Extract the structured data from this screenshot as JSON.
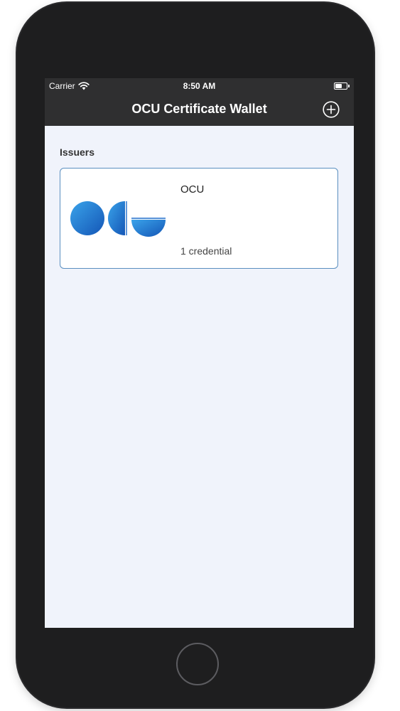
{
  "status_bar": {
    "carrier": "Carrier",
    "time": "8:50 AM",
    "icons": [
      "wifi-icon",
      "battery-icon"
    ]
  },
  "nav_bar": {
    "title": "OCU Certificate Wallet",
    "add_icon": "plus-circle-icon"
  },
  "main": {
    "section_header": "Issuers",
    "issuers": [
      {
        "name": "OCU",
        "credentials_label": "1 credential",
        "logo_icon": "ocu-logo"
      }
    ]
  },
  "device": {
    "home_button_icon": "home-button"
  },
  "colors": {
    "bar_background": "#2f2f30",
    "screen_background": "#f0f3fb",
    "card_border": "#5a8fc0",
    "logo_blue_light": "#3aa3ea",
    "logo_blue_dark": "#1456b6",
    "device_frame": "#1e1e1f"
  }
}
